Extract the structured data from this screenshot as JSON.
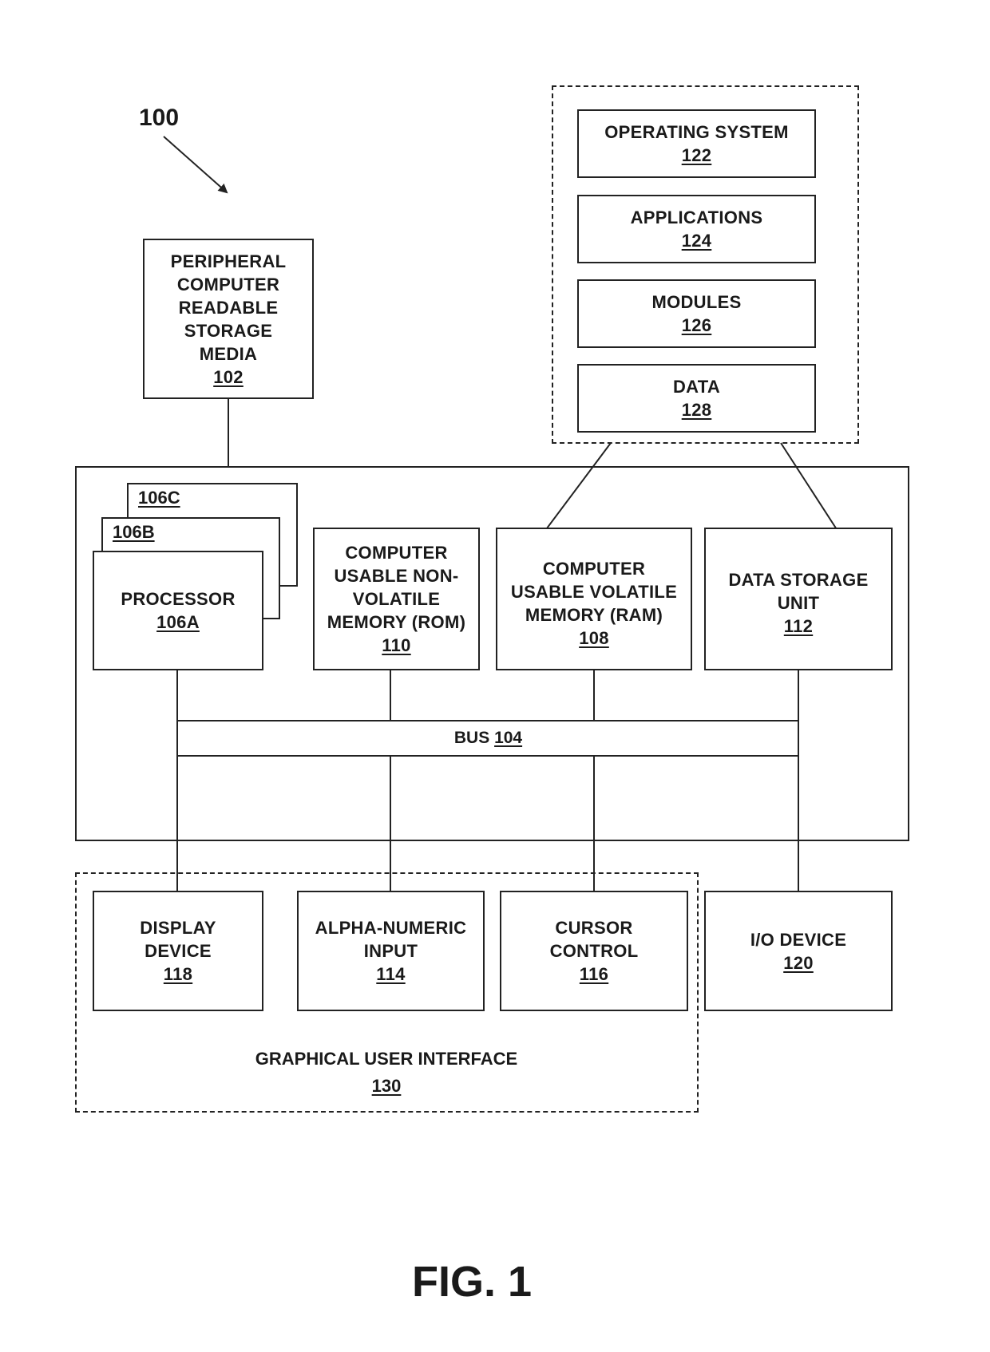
{
  "figure": {
    "reference_number": "100",
    "caption": "FIG. 1"
  },
  "peripheral": {
    "label": "PERIPHERAL\nCOMPUTER\nREADABLE\nSTORAGE\nMEDIA",
    "ref": "102"
  },
  "software_group": {
    "items": [
      {
        "label": "OPERATING SYSTEM",
        "ref": "122"
      },
      {
        "label": "APPLICATIONS",
        "ref": "124"
      },
      {
        "label": "MODULES",
        "ref": "126"
      },
      {
        "label": "DATA",
        "ref": "128"
      }
    ]
  },
  "processors": {
    "c": {
      "ref": "106C"
    },
    "b": {
      "ref": "106B"
    },
    "a": {
      "label": "PROCESSOR",
      "ref": "106A"
    }
  },
  "rom": {
    "label": "COMPUTER\nUSABLE NON-\nVOLATILE\nMEMORY (ROM)",
    "ref": "110"
  },
  "ram": {
    "label": "COMPUTER\nUSABLE VOLATILE\nMEMORY (RAM)",
    "ref": "108"
  },
  "data_storage": {
    "label": "DATA STORAGE\nUNIT",
    "ref": "112"
  },
  "bus": {
    "label": "BUS",
    "ref": "104"
  },
  "devices": {
    "display": {
      "label": "DISPLAY\nDEVICE",
      "ref": "118"
    },
    "alpha": {
      "label": "ALPHA-NUMERIC\nINPUT",
      "ref": "114"
    },
    "cursor": {
      "label": "CURSOR\nCONTROL",
      "ref": "116"
    },
    "io": {
      "label": "I/O DEVICE",
      "ref": "120"
    }
  },
  "gui": {
    "label": "GRAPHICAL USER INTERFACE",
    "ref": "130"
  }
}
